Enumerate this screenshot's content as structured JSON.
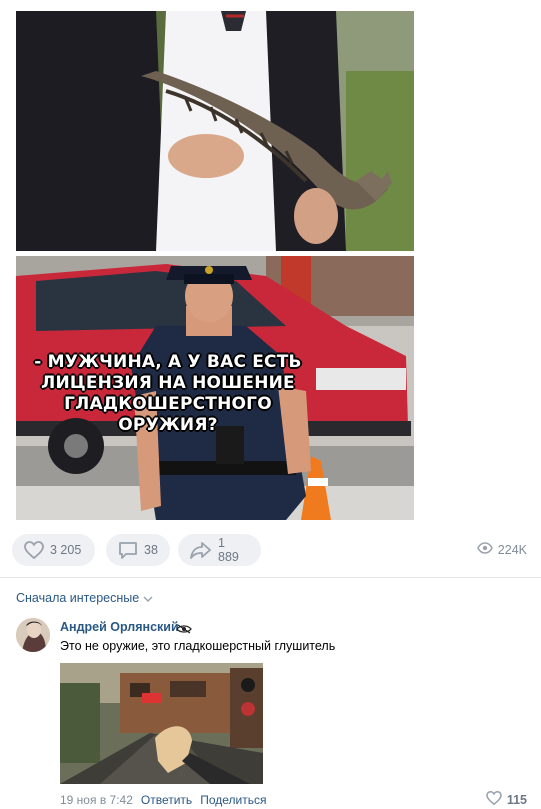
{
  "post": {
    "meme_caption": "- мужчина, а у вас есть лицензия на ношение гладкошерстного оружия?",
    "actions": {
      "likes": "3 205",
      "comments": "38",
      "shares": "1 889",
      "views": "224K"
    }
  },
  "comments_section": {
    "sort_label": "Сначала интересные",
    "comment": {
      "author": "Андрей Орлянский",
      "text": "Это не оружие, это гладкошерстный глушитель",
      "date": "19 ноя в 7:42",
      "reply_label": "Ответить",
      "share_label": "Поделиться",
      "likes": "115"
    }
  },
  "colors": {
    "link": "#2a5885",
    "muted": "#818c99",
    "button_bg": "#eef0f3"
  }
}
